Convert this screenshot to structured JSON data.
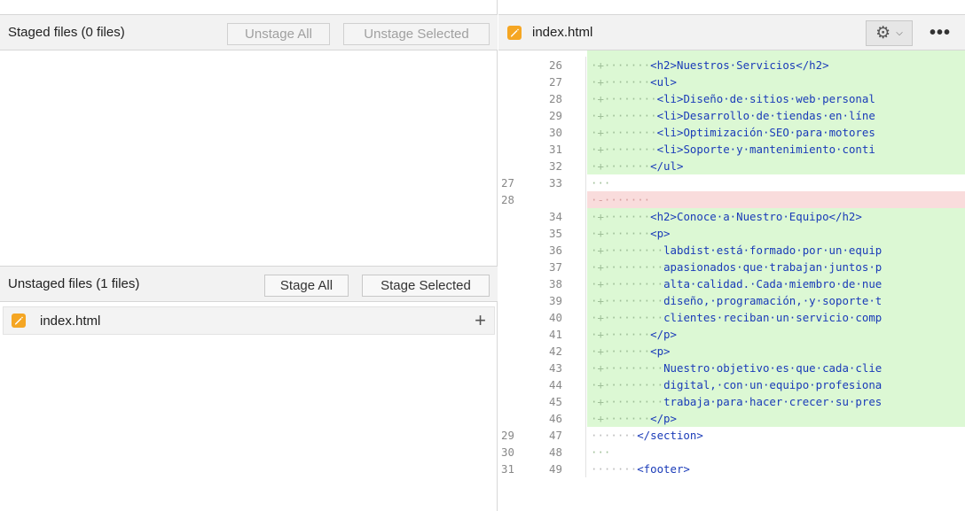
{
  "staged": {
    "title": "Staged files  (0 files)",
    "unstage_all_label": "Unstage All",
    "unstage_selected_label": "Unstage Selected"
  },
  "unstaged": {
    "title": "Unstaged files  (1 files)",
    "stage_all_label": "Stage All",
    "stage_selected_label": "Stage Selected",
    "files": [
      {
        "name": "index.html",
        "icon": "edit-file-icon",
        "action": "+"
      }
    ]
  },
  "editor": {
    "tab_name": "index.html",
    "settings_icon": "gear-icon",
    "more_label": "•••",
    "colors": {
      "added_bg": "#dcf8d4",
      "removed_bg": "#f9dcdc",
      "file_icon": "#f5a623"
    },
    "lines": [
      {
        "type": "add",
        "old": "",
        "new": "26",
        "indent": "·+·······",
        "code": "<h2>Nuestros·Servicios</h2>"
      },
      {
        "type": "add",
        "old": "",
        "new": "27",
        "indent": "·+·······",
        "code": "<ul>"
      },
      {
        "type": "add",
        "old": "",
        "new": "28",
        "indent": "·+········",
        "code": "<li>Diseño·de·sitios·web·personal"
      },
      {
        "type": "add",
        "old": "",
        "new": "29",
        "indent": "·+········",
        "code": "<li>Desarrollo·de·tiendas·en·líne"
      },
      {
        "type": "add",
        "old": "",
        "new": "30",
        "indent": "·+········",
        "code": "<li>Optimización·SEO·para·motores"
      },
      {
        "type": "add",
        "old": "",
        "new": "31",
        "indent": "·+········",
        "code": "<li>Soporte·y·mantenimiento·conti"
      },
      {
        "type": "add",
        "old": "",
        "new": "32",
        "indent": "·+·······",
        "code": "</ul>"
      },
      {
        "type": "sep",
        "old": "27",
        "new": "33",
        "indent": "···",
        "code": ""
      },
      {
        "type": "del",
        "old": "28",
        "new": "",
        "indent": "·-·······",
        "code": ""
      },
      {
        "type": "add",
        "old": "",
        "new": "34",
        "indent": "·+·······",
        "code": "<h2>Conoce·a·Nuestro·Equipo</h2>"
      },
      {
        "type": "add",
        "old": "",
        "new": "35",
        "indent": "·+·······",
        "code": "<p>"
      },
      {
        "type": "add",
        "old": "",
        "new": "36",
        "indent": "·+·········",
        "code": "labdist·está·formado·por·un·equip"
      },
      {
        "type": "add",
        "old": "",
        "new": "37",
        "indent": "·+·········",
        "code": "apasionados·que·trabajan·juntos·p"
      },
      {
        "type": "add",
        "old": "",
        "new": "38",
        "indent": "·+·········",
        "code": "alta·calidad.·Cada·miembro·de·nue"
      },
      {
        "type": "add",
        "old": "",
        "new": "39",
        "indent": "·+·········",
        "code": "diseño,·programación,·y·soporte·t"
      },
      {
        "type": "add",
        "old": "",
        "new": "40",
        "indent": "·+·········",
        "code": "clientes·reciban·un·servicio·comp"
      },
      {
        "type": "add",
        "old": "",
        "new": "41",
        "indent": "·+·······",
        "code": "</p>"
      },
      {
        "type": "add",
        "old": "",
        "new": "42",
        "indent": "·+·······",
        "code": "<p>"
      },
      {
        "type": "add",
        "old": "",
        "new": "43",
        "indent": "·+·········",
        "code": "Nuestro·objetivo·es·que·cada·clie"
      },
      {
        "type": "add",
        "old": "",
        "new": "44",
        "indent": "·+·········",
        "code": "digital,·con·un·equipo·profesiona"
      },
      {
        "type": "add",
        "old": "",
        "new": "45",
        "indent": "·+·········",
        "code": "trabaja·para·hacer·crecer·su·pres"
      },
      {
        "type": "add",
        "old": "",
        "new": "46",
        "indent": "·+·······",
        "code": "</p>"
      },
      {
        "type": "ctx",
        "old": "29",
        "new": "47",
        "indent": "·······",
        "code": "</section>"
      },
      {
        "type": "sep",
        "old": "30",
        "new": "48",
        "indent": "···",
        "code": ""
      },
      {
        "type": "ctx",
        "old": "31",
        "new": "49",
        "indent": "·······",
        "code": "<footer>"
      }
    ]
  }
}
